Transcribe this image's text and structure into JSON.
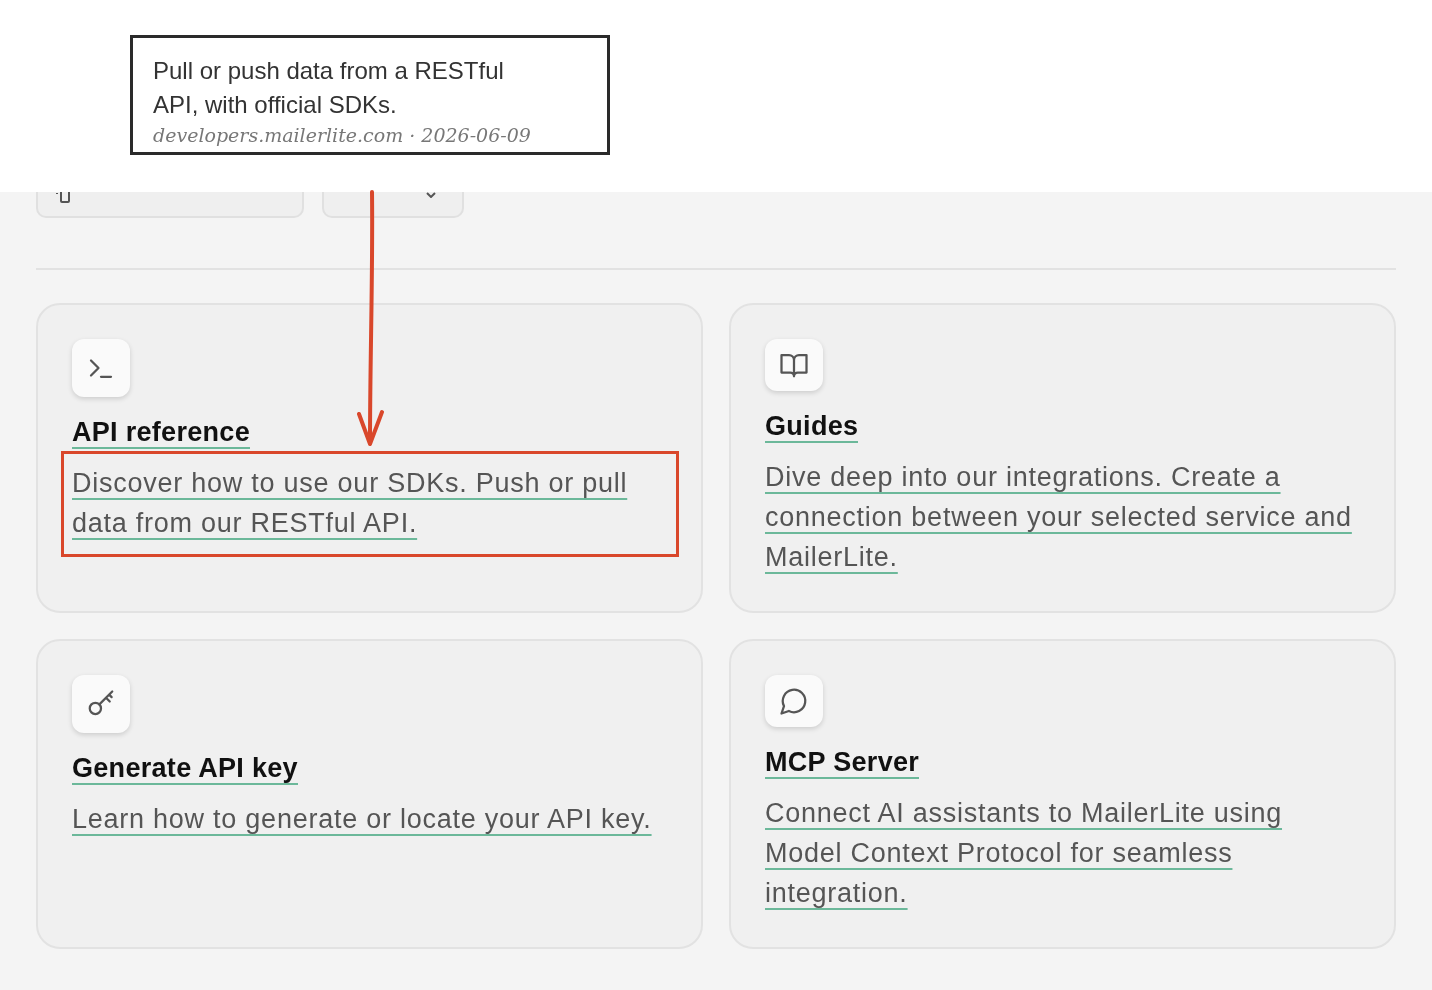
{
  "callout": {
    "text": "Pull or push data from a RESTful API, with official SDKs.",
    "source": "developers.mailerlite.com · 2026-06-09"
  },
  "toolbar": {
    "buttons": [
      {
        "kind": "copy"
      },
      {
        "kind": "dropdown"
      }
    ]
  },
  "cards": [
    {
      "kind": "terminal",
      "title": "API reference",
      "description": "Discover how to use our SDKs. Push or pull data from our RESTful API.",
      "highlighted": true
    },
    {
      "kind": "book",
      "title": "Guides",
      "description": "Dive deep into our integrations. Create a connection between your selected service and MailerLite.",
      "highlighted": false
    },
    {
      "kind": "key",
      "title": "Generate API key",
      "description": "Learn how to generate or locate your API key.",
      "highlighted": false
    },
    {
      "kind": "chat",
      "title": "MCP Server",
      "description": "Connect AI assistants to MailerLite using Model Context Protocol for seamless integration.",
      "highlighted": false
    }
  ]
}
